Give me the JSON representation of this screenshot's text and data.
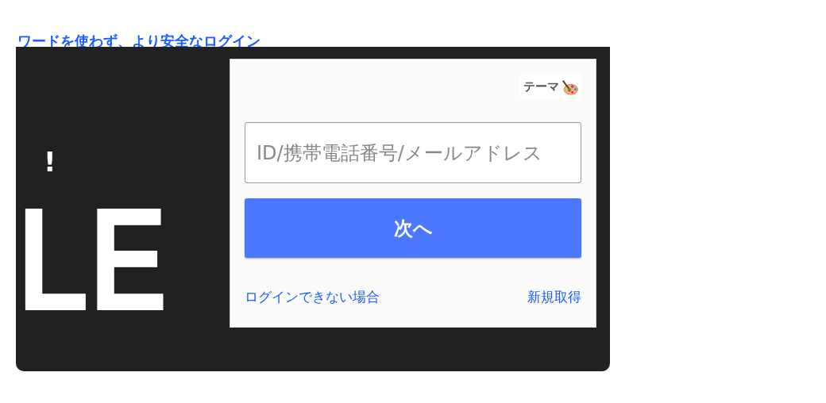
{
  "heading": "ワードを使わず、より安全なログイン",
  "banner": {
    "exclaim": "!",
    "big_text": "LE"
  },
  "login": {
    "theme_button": "テーマ",
    "id_field": {
      "placeholder": "ID/携帯電話番号/メールアドレス"
    },
    "next_button": "次へ",
    "links": [
      "ログインできない場合",
      "新規取得"
    ]
  }
}
